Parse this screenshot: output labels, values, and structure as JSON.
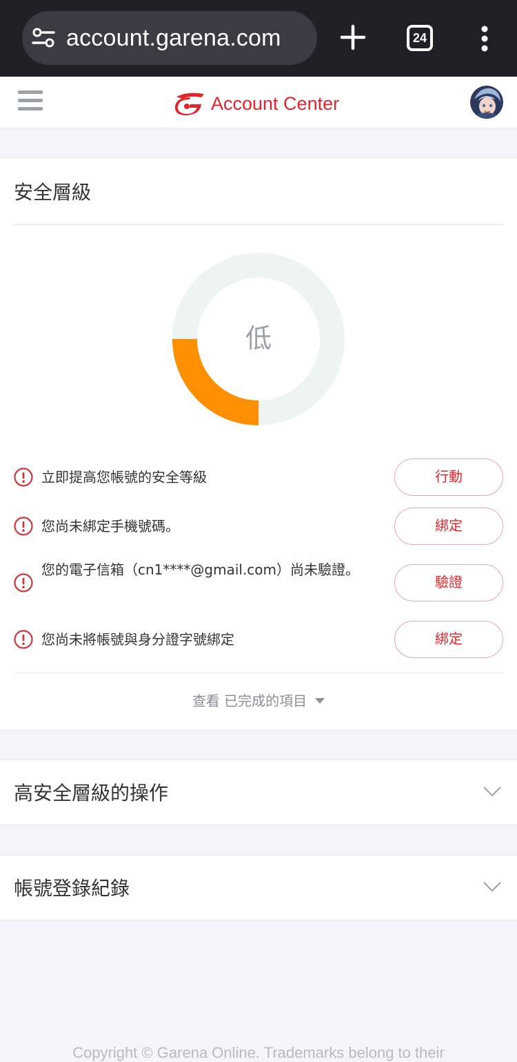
{
  "browser": {
    "url": "account.garena.com",
    "tab_count": "24",
    "icons": {
      "site_settings": "tune-icon",
      "new_tab": "plus-icon",
      "tabs": "tab-switcher-icon",
      "menu": "more-vert-icon"
    }
  },
  "header": {
    "brand": "Account Center",
    "menu_icon": "hamburger-menu-icon",
    "brand_color": "#e1252c"
  },
  "security": {
    "title": "安全層級",
    "level_label": "低",
    "level_fraction": 0.25,
    "ring_color": "#fd8f00",
    "ring_track_color": "#eef4f2",
    "tasks": [
      {
        "text": "立即提高您帳號的安全等級",
        "button": "行動"
      },
      {
        "text": "您尚未綁定手機號碼。",
        "button": "綁定"
      },
      {
        "text": "您的電子信箱（cn1****@gmail.com）尚未驗證。",
        "button": "驗證"
      },
      {
        "text": "您尚未將帳號與身分證字號綁定",
        "button": "綁定"
      }
    ],
    "view_completed": "查看 已完成的項目"
  },
  "sections": [
    {
      "title": "高安全層級的操作"
    },
    {
      "title": "帳號登錄紀錄"
    }
  ],
  "footer": {
    "copyright": "Copyright © Garena Online. Trademarks belong to their"
  }
}
